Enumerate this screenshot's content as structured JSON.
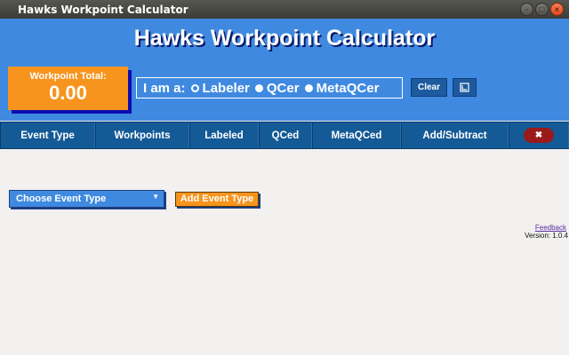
{
  "window": {
    "title": "Hawks Workpoint Calculator",
    "controls": {
      "minimize": "–",
      "maximize": "□",
      "close": "×"
    }
  },
  "header": {
    "title": "Hawks Workpoint Calculator",
    "total_label": "Workpoint Total:",
    "total_value": "0.00",
    "role_label": "I am a:",
    "roles": [
      {
        "label": "Labeler",
        "selected": true
      },
      {
        "label": "QCer",
        "selected": false
      },
      {
        "label": "MetaQCer",
        "selected": false
      }
    ],
    "clear_label": "Clear",
    "export_icon": "export-icon"
  },
  "table": {
    "columns": [
      "Event Type",
      "Workpoints",
      "Labeled",
      "QCed",
      "MetaQCed",
      "Add/Subtract"
    ],
    "remove_icon": "✖"
  },
  "controls": {
    "select_value": "Choose Event Type",
    "add_label": "Add Event Type"
  },
  "footer": {
    "feedback": "Feedback",
    "version": "Version: 1.0.4"
  },
  "colors": {
    "accent_blue": "#3f8ae0",
    "header_dark": "#145a96",
    "orange": "#f7941d",
    "remove_red": "#9b1a1a"
  }
}
